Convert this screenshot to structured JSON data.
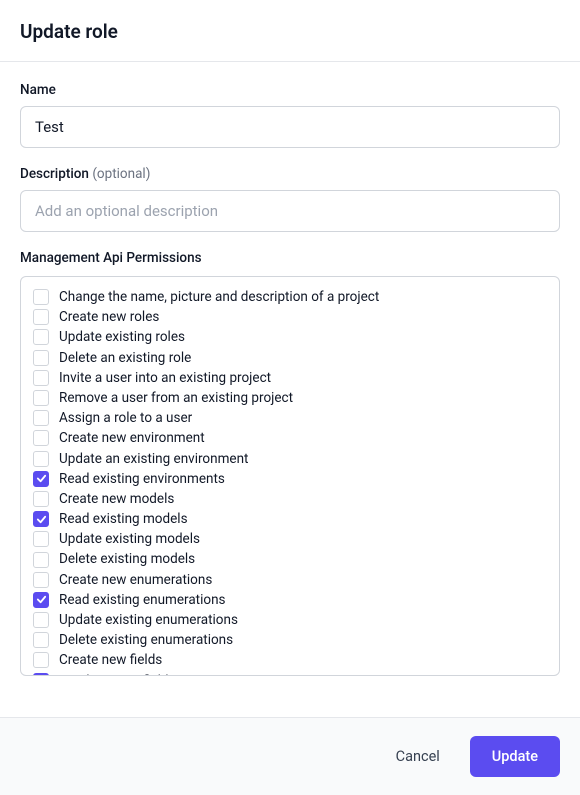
{
  "header": {
    "title": "Update role"
  },
  "form": {
    "name": {
      "label": "Name",
      "value": "Test"
    },
    "description": {
      "label": "Description",
      "optional_tag": "(optional)",
      "placeholder": "Add an optional description",
      "value": ""
    }
  },
  "permissions": {
    "label": "Management Api Permissions",
    "items": [
      {
        "label": "Change the name, picture and description of a project",
        "checked": false
      },
      {
        "label": "Create new roles",
        "checked": false
      },
      {
        "label": "Update existing roles",
        "checked": false
      },
      {
        "label": "Delete an existing role",
        "checked": false
      },
      {
        "label": "Invite a user into an existing project",
        "checked": false
      },
      {
        "label": "Remove a user from an existing project",
        "checked": false
      },
      {
        "label": "Assign a role to a user",
        "checked": false
      },
      {
        "label": "Create new environment",
        "checked": false
      },
      {
        "label": "Update an existing environment",
        "checked": false
      },
      {
        "label": "Read existing environments",
        "checked": true
      },
      {
        "label": "Create new models",
        "checked": false
      },
      {
        "label": "Read existing models",
        "checked": true
      },
      {
        "label": "Update existing models",
        "checked": false
      },
      {
        "label": "Delete existing models",
        "checked": false
      },
      {
        "label": "Create new enumerations",
        "checked": false
      },
      {
        "label": "Read existing enumerations",
        "checked": true
      },
      {
        "label": "Update existing enumerations",
        "checked": false
      },
      {
        "label": "Delete existing enumerations",
        "checked": false
      },
      {
        "label": "Create new fields",
        "checked": false
      },
      {
        "label": "Read existing fields",
        "checked": true
      }
    ]
  },
  "footer": {
    "cancel": "Cancel",
    "update": "Update"
  }
}
